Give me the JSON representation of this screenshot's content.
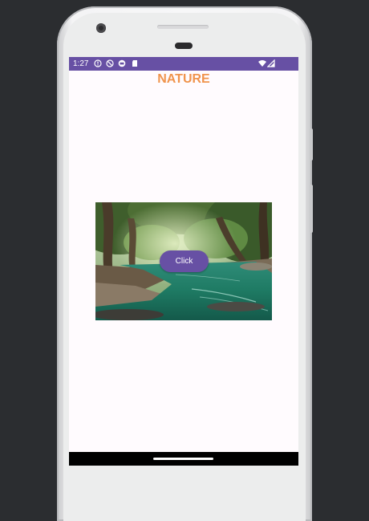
{
  "status_bar": {
    "time": "1:27",
    "background": "#6750a4",
    "left_icons": [
      "alert-circle-icon",
      "do-not-disturb-icon",
      "app-notification-icon",
      "sd-card-icon"
    ],
    "right_icons": [
      "wifi-icon",
      "cell-signal-icon"
    ]
  },
  "app": {
    "title": "NATURE",
    "title_color": "#f0944d",
    "background": "#fffbfe"
  },
  "image": {
    "subject": "forest river with green water"
  },
  "button": {
    "label": "Click",
    "color": "#6750a4"
  }
}
